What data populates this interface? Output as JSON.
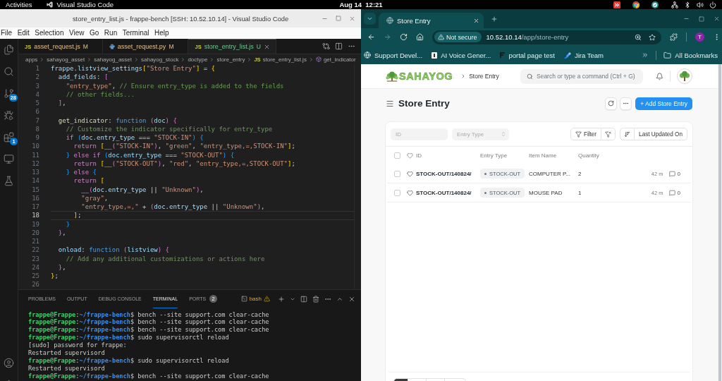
{
  "top_bar": {
    "activities": "Activities",
    "app_name": "Visual Studio Code",
    "clock": "Aug 14  12:21"
  },
  "editor_window": {
    "title": "store_entry_list.js - frappe-bench [SSH: 10.52.10.14] - Visual Studio Code",
    "menu": [
      "File",
      "Edit",
      "Selection",
      "View",
      "Go",
      "Run",
      "Terminal",
      "Help"
    ],
    "activity_bar": [
      {
        "kind": "explorer"
      },
      {
        "kind": "search"
      },
      {
        "kind": "source-control",
        "badge": "28"
      },
      {
        "kind": "run"
      },
      {
        "kind": "extensions",
        "badge": "1"
      },
      {
        "kind": "remote"
      },
      {
        "kind": "testing"
      }
    ],
    "activity_bar_bottom": [
      {
        "kind": "account"
      },
      {
        "kind": "settings"
      }
    ],
    "tabs": [
      {
        "kind": "js",
        "type_label": "JS",
        "label": "asset_request.js",
        "untracked": false,
        "status": "M",
        "selected": false
      },
      {
        "kind": "python",
        "label": "asset_request.py",
        "untracked": false,
        "status": "M",
        "selected": false
      },
      {
        "kind": "js",
        "type_label": "JS",
        "label": "store_entry_list.js",
        "untracked": true,
        "status": "U",
        "selected": true
      }
    ],
    "breadcrumb": [
      {
        "kind": "folder",
        "label": "apps"
      },
      {
        "kind": "folder",
        "label": "sahayog_asset"
      },
      {
        "kind": "folder",
        "label": "sahayog_asset"
      },
      {
        "kind": "folder",
        "label": "sahayog_stock"
      },
      {
        "kind": "folder",
        "label": "doctype"
      },
      {
        "kind": "folder",
        "label": "store_entry"
      },
      {
        "kind": "file",
        "type_label": "JS",
        "label": "store_entry_list.js"
      },
      {
        "kind": "symbol",
        "label": "get_indicator"
      }
    ],
    "code": [
      {
        "number": "1",
        "active": false,
        "tokens": [
          {
            "kind": "variable",
            "text": "frappe.listview_settings"
          },
          {
            "kind": "bracket-1",
            "text": "["
          },
          {
            "kind": "string",
            "text": "\"Store Entry\""
          },
          {
            "kind": "bracket-1",
            "text": "]"
          },
          {
            "kind": "plain",
            "text": " = "
          },
          {
            "kind": "bracket-1",
            "text": "{"
          }
        ]
      },
      {
        "number": "2",
        "active": false,
        "tokens": [
          {
            "kind": "variable",
            "text": "  add_fields"
          },
          {
            "kind": "plain",
            "text": ": "
          },
          {
            "kind": "bracket-2",
            "text": "["
          }
        ]
      },
      {
        "number": "3",
        "active": false,
        "tokens": [
          {
            "kind": "string",
            "text": "    \"entry_type\""
          },
          {
            "kind": "plain",
            "text": ", "
          },
          {
            "kind": "comment",
            "text": "// Ensure entry_type is added to the fields"
          }
        ]
      },
      {
        "number": "4",
        "active": false,
        "tokens": [
          {
            "kind": "comment",
            "text": "    // other fields..."
          }
        ]
      },
      {
        "number": "5",
        "active": false,
        "tokens": [
          {
            "kind": "bracket-2",
            "text": "  ]"
          },
          {
            "kind": "plain",
            "text": ","
          }
        ]
      },
      {
        "number": "6",
        "active": false
      },
      {
        "number": "7",
        "active": false,
        "tokens": [
          {
            "kind": "function",
            "text": "  get_indicator"
          },
          {
            "kind": "plain",
            "text": ": "
          },
          {
            "kind": "storage",
            "text": "function "
          },
          {
            "kind": "bracket-2",
            "text": "("
          },
          {
            "kind": "variable",
            "text": "doc"
          },
          {
            "kind": "bracket-2",
            "text": ") {"
          }
        ]
      },
      {
        "number": "8",
        "active": false,
        "tokens": [
          {
            "kind": "comment",
            "text": "    // Customize the indicator specifically for entry_type"
          }
        ]
      },
      {
        "number": "9",
        "active": false,
        "tokens": [
          {
            "kind": "keyword",
            "text": "    if "
          },
          {
            "kind": "bracket-3",
            "text": "("
          },
          {
            "kind": "variable",
            "text": "doc.entry_type"
          },
          {
            "kind": "plain",
            "text": " === "
          },
          {
            "kind": "string",
            "text": "\"STOCK-IN\""
          },
          {
            "kind": "bracket-3",
            "text": ") {"
          }
        ]
      },
      {
        "number": "10",
        "active": false,
        "tokens": [
          {
            "kind": "keyword",
            "text": "      return "
          },
          {
            "kind": "bracket-1",
            "text": "["
          },
          {
            "kind": "function",
            "text": "__"
          },
          {
            "kind": "bracket-2",
            "text": "("
          },
          {
            "kind": "string",
            "text": "\"STOCK-IN\""
          },
          {
            "kind": "bracket-2",
            "text": ")"
          },
          {
            "kind": "plain",
            "text": ", "
          },
          {
            "kind": "string",
            "text": "\"green\""
          },
          {
            "kind": "plain",
            "text": ", "
          },
          {
            "kind": "string",
            "text": "\"entry_type,=,STOCK-IN\""
          },
          {
            "kind": "bracket-1",
            "text": "]"
          },
          {
            "kind": "plain",
            "text": ";"
          }
        ]
      },
      {
        "number": "11",
        "active": false,
        "tokens": [
          {
            "kind": "bracket-3",
            "text": "    } "
          },
          {
            "kind": "keyword",
            "text": "else if "
          },
          {
            "kind": "bracket-3",
            "text": "("
          },
          {
            "kind": "variable",
            "text": "doc.entry_type"
          },
          {
            "kind": "plain",
            "text": " === "
          },
          {
            "kind": "string",
            "text": "\"STOCK-OUT\""
          },
          {
            "kind": "bracket-3",
            "text": ") {"
          }
        ]
      },
      {
        "number": "12",
        "active": false,
        "tokens": [
          {
            "kind": "keyword",
            "text": "      return "
          },
          {
            "kind": "bracket-1",
            "text": "["
          },
          {
            "kind": "function",
            "text": "__"
          },
          {
            "kind": "bracket-2",
            "text": "("
          },
          {
            "kind": "string",
            "text": "\"STOCK-OUT\""
          },
          {
            "kind": "bracket-2",
            "text": ")"
          },
          {
            "kind": "plain",
            "text": ", "
          },
          {
            "kind": "string",
            "text": "\"red\""
          },
          {
            "kind": "plain",
            "text": ", "
          },
          {
            "kind": "string",
            "text": "\"entry_type,=,STOCK-OUT\""
          },
          {
            "kind": "bracket-1",
            "text": "]"
          },
          {
            "kind": "plain",
            "text": ";"
          }
        ]
      },
      {
        "number": "13",
        "active": false,
        "tokens": [
          {
            "kind": "bracket-3",
            "text": "    } "
          },
          {
            "kind": "keyword",
            "text": "else "
          },
          {
            "kind": "bracket-3",
            "text": "{"
          }
        ]
      },
      {
        "number": "14",
        "active": false,
        "tokens": [
          {
            "kind": "keyword",
            "text": "      return "
          },
          {
            "kind": "bracket-1",
            "text": "["
          }
        ]
      },
      {
        "number": "15",
        "active": false,
        "tokens": [
          {
            "kind": "function",
            "text": "        __"
          },
          {
            "kind": "bracket-2",
            "text": "("
          },
          {
            "kind": "variable",
            "text": "doc.entry_type"
          },
          {
            "kind": "plain",
            "text": " || "
          },
          {
            "kind": "string",
            "text": "\"Unknown\""
          },
          {
            "kind": "bracket-2",
            "text": ")"
          },
          {
            "kind": "plain",
            "text": ","
          }
        ]
      },
      {
        "number": "16",
        "active": false,
        "tokens": [
          {
            "kind": "string",
            "text": "        \"gray\""
          },
          {
            "kind": "plain",
            "text": ","
          }
        ]
      },
      {
        "number": "17",
        "active": false,
        "tokens": [
          {
            "kind": "string",
            "text": "        \"entry_type,=,\""
          },
          {
            "kind": "plain",
            "text": " + "
          },
          {
            "kind": "bracket-2",
            "text": "("
          },
          {
            "kind": "variable",
            "text": "doc.entry_type"
          },
          {
            "kind": "plain",
            "text": " || "
          },
          {
            "kind": "string",
            "text": "\"Unknown\""
          },
          {
            "kind": "bracket-2",
            "text": ")"
          },
          {
            "kind": "plain",
            "text": ","
          }
        ]
      },
      {
        "number": "18",
        "active": true,
        "tokens": [
          {
            "kind": "bracket-1",
            "text": "      ]"
          },
          {
            "kind": "plain",
            "text": ";"
          }
        ]
      },
      {
        "number": "19",
        "active": false,
        "tokens": [
          {
            "kind": "bracket-3",
            "text": "    }"
          }
        ]
      },
      {
        "number": "20",
        "active": false,
        "tokens": [
          {
            "kind": "bracket-2",
            "text": "  }"
          },
          {
            "kind": "plain",
            "text": ","
          }
        ]
      },
      {
        "number": "21",
        "active": false
      },
      {
        "number": "22",
        "active": false,
        "tokens": [
          {
            "kind": "variable",
            "text": "  onload"
          },
          {
            "kind": "plain",
            "text": ": "
          },
          {
            "kind": "storage",
            "text": "function "
          },
          {
            "kind": "bracket-2",
            "text": "("
          },
          {
            "kind": "variable",
            "text": "listview"
          },
          {
            "kind": "bracket-2",
            "text": ") {"
          }
        ]
      },
      {
        "number": "23",
        "active": false,
        "tokens": [
          {
            "kind": "comment",
            "text": "    // Add any additional customizations or actions here"
          }
        ]
      },
      {
        "number": "24",
        "active": false,
        "tokens": [
          {
            "kind": "bracket-2",
            "text": "  }"
          },
          {
            "kind": "plain",
            "text": ","
          }
        ]
      },
      {
        "number": "25",
        "active": false,
        "tokens": [
          {
            "kind": "bracket-1",
            "text": "}"
          },
          {
            "kind": "plain",
            "text": ";"
          }
        ]
      },
      {
        "number": "26",
        "active": false
      }
    ],
    "panel": {
      "tabs": [
        {
          "label": "PROBLEMS",
          "selected": false
        },
        {
          "label": "OUTPUT",
          "selected": false
        },
        {
          "label": "DEBUG CONSOLE",
          "selected": false
        },
        {
          "label": "TERMINAL",
          "selected": true
        },
        {
          "label": "PORTS",
          "badge": "2",
          "selected": false
        }
      ],
      "shell": "bash"
    },
    "terminal": [
      {
        "kind": "prompt",
        "user": "frappe@Frappe",
        "separator": ":",
        "path": "~/frappe-bench",
        "command": "$ bench --site support.com clear-cache"
      },
      {
        "kind": "prompt",
        "user": "frappe@Frappe",
        "separator": ":",
        "path": "~/frappe-bench",
        "command": "$ bench --site support.com clear-cache"
      },
      {
        "kind": "prompt",
        "user": "frappe@Frappe",
        "separator": ":",
        "path": "~/frappe-bench",
        "command": "$ bench --site support.com clear-cache"
      },
      {
        "kind": "prompt",
        "user": "frappe@Frappe",
        "separator": ":",
        "path": "~/frappe-bench",
        "command": "$ sudo supervisorctl reload"
      },
      {
        "kind": "output",
        "text": "[sudo] password for frappe:"
      },
      {
        "kind": "output",
        "text": "Restarted supervisord"
      },
      {
        "kind": "prompt",
        "user": "frappe@Frappe",
        "separator": ":",
        "path": "~/frappe-bench",
        "command": "$ sudo supervisorctl reload"
      },
      {
        "kind": "output",
        "text": "Restarted supervisord"
      },
      {
        "kind": "prompt",
        "user": "frappe@Frappe",
        "separator": ":",
        "path": "~/frappe-bench",
        "command": "$ bench --site support.com clear-cache"
      }
    ]
  },
  "browser": {
    "tab_title": "Store Entry",
    "nav": [
      {
        "kind": "back",
        "disabled": false
      },
      {
        "kind": "forward",
        "disabled": true
      },
      {
        "kind": "reload",
        "disabled": false
      },
      {
        "kind": "home",
        "disabled": false
      }
    ],
    "security": "Not secure",
    "url_host": "10.52.10.14",
    "url_path": "/app/store-entry",
    "profile_initial": "T",
    "bookmarks": [
      {
        "kind": "globe",
        "label": "Support Devel..."
      },
      {
        "kind": "document",
        "label": "AI Voice Gener..."
      },
      {
        "kind": "letter-mark",
        "label": "portal page test"
      },
      {
        "kind": "arrows",
        "label": "Jira Team"
      }
    ],
    "bookmarks_folder": "All Bookmarks"
  },
  "app": {
    "logo_text": "SAHAYOG",
    "breadcrumb": "Store Entry",
    "search_placeholder": "Search or type a command (Ctrl + G)",
    "title": "Store Entry",
    "primary_action": "+ Add Store Entry",
    "filters": [
      {
        "kind": "text",
        "placeholder": "ID"
      },
      {
        "kind": "select",
        "placeholder": "Entry Type"
      }
    ],
    "filter_label": "Filter",
    "sort_label": "Last Updated On",
    "table": {
      "all_selected": false,
      "columns": [
        "ID",
        "Entry Type",
        "Item Name",
        "Quantity"
      ],
      "rows": [
        {
          "selected": false,
          "liked": false,
          "id": "STOCK-OUT/140824/",
          "status": {
            "label": "STOCK-OUT",
            "color": "#6b7280"
          },
          "item_name": "COMPUTER P...",
          "quantity": "2",
          "modified": "42 m",
          "comments": "0"
        },
        {
          "selected": false,
          "liked": false,
          "id": "STOCK-OUT/140824/",
          "status": {
            "label": "STOCK-OUT",
            "color": "#6b7280"
          },
          "item_name": "MOUSE PAD",
          "quantity": "1",
          "modified": "42 m",
          "comments": "0"
        }
      ]
    },
    "pager": [
      {
        "selected": true
      },
      {
        "selected": false
      },
      {
        "selected": false
      },
      {
        "selected": false
      }
    ]
  }
}
